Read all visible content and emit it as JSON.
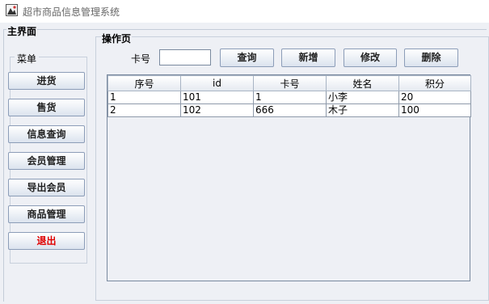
{
  "window": {
    "title": "超市商品信息管理系统"
  },
  "main_panel": {
    "label": "主界面"
  },
  "menu": {
    "label": "菜单",
    "items": [
      "进货",
      "售货",
      "信息查询",
      "会员管理",
      "导出会员",
      "商品管理",
      "退出"
    ],
    "exit_color": "#e00000"
  },
  "operation": {
    "label": "操作页",
    "card_label": "卡号",
    "card_value": "",
    "buttons": [
      "查询",
      "新增",
      "修改",
      "删除"
    ]
  },
  "table": {
    "headers": [
      "序号",
      "id",
      "卡号",
      "姓名",
      "积分"
    ],
    "rows": [
      [
        "1",
        "101",
        "1",
        "小李",
        "20"
      ],
      [
        "2",
        "102",
        "666",
        "木子",
        "100"
      ]
    ]
  }
}
